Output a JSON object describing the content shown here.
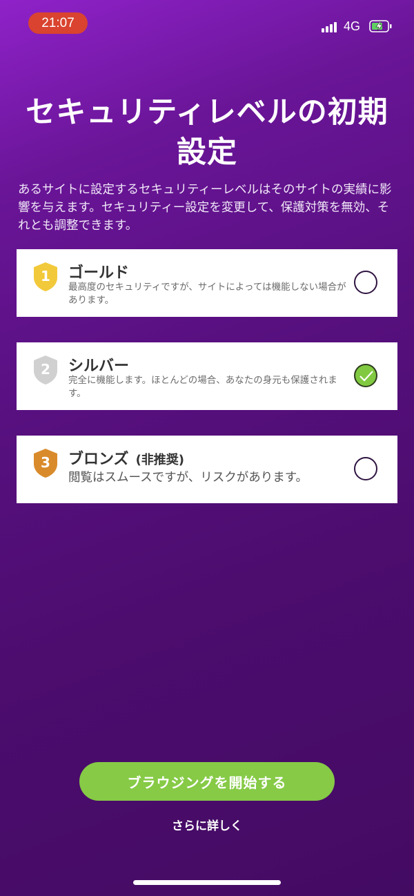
{
  "status_bar": {
    "time": "21:07",
    "network": "4G"
  },
  "title": "セキュリティレベルの初期設定",
  "description": "あるサイトに設定するセキュリティーレベルはそのサイトの実績に影響を与えます。セキュリティー設定を変更して、保護対策を無効、それとも調整できます。",
  "options": [
    {
      "number": "1",
      "title": "ゴールド",
      "subtitle": "",
      "description": "最高度のセキュリティですが、サイトによっては機能しない場合があります。",
      "selected": false,
      "shield_color": "#f2c93a"
    },
    {
      "number": "2",
      "title": "シルバー",
      "subtitle": "",
      "description": "完全に機能します。ほとんどの場合、あなたの身元も保護されます。",
      "selected": true,
      "shield_color": "#d0d0d0"
    },
    {
      "number": "3",
      "title": "ブロンズ",
      "subtitle": "(非推奨)",
      "description": "閲覧はスムースですが、リスクがあります。",
      "selected": false,
      "shield_color": "#d98b2c"
    }
  ],
  "start_button": "ブラウジングを開始する",
  "learn_more": "さらに詳しく",
  "colors": {
    "accent": "#86ca46",
    "background": "#581080",
    "time_pill": "#d9432f"
  }
}
